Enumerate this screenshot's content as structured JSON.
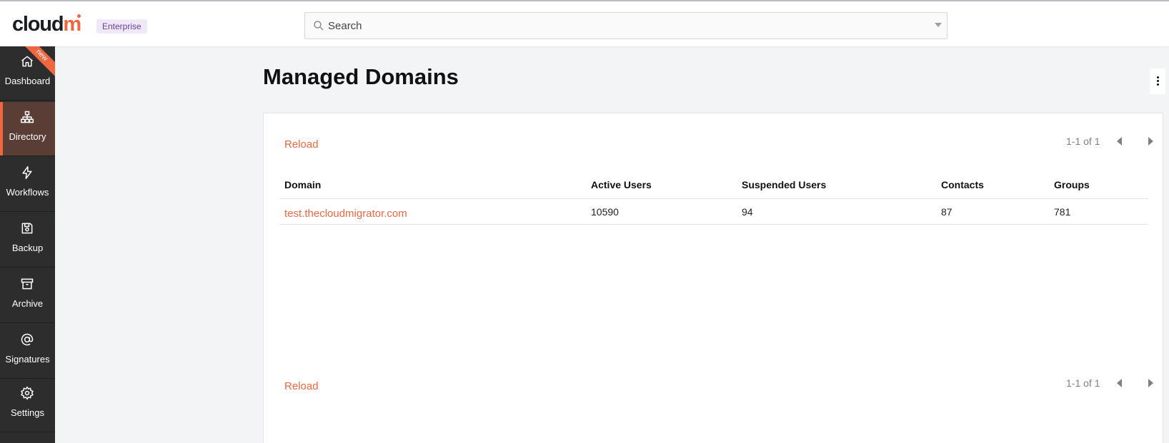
{
  "header": {
    "logo_text": "cloudm",
    "plan_badge": "Enterprise",
    "search": {
      "placeholder": "Search",
      "value": ""
    }
  },
  "sidebar": {
    "items": [
      {
        "label": "Dashboard",
        "icon": "home-icon",
        "ribbon": "new"
      },
      {
        "label": "Directory",
        "icon": "sitemap-icon",
        "active": true
      },
      {
        "label": "Workflows",
        "icon": "bolt-icon"
      },
      {
        "label": "Backup",
        "icon": "save-icon"
      },
      {
        "label": "Archive",
        "icon": "archive-box-icon"
      },
      {
        "label": "Signatures",
        "icon": "at-sign-icon"
      },
      {
        "label": "Settings",
        "icon": "gear-icon"
      }
    ]
  },
  "main": {
    "title": "Managed Domains",
    "reload_label": "Reload",
    "pager_text": "1-1 of 1",
    "table": {
      "columns": [
        "Domain",
        "Active Users",
        "Suspended Users",
        "Contacts",
        "Groups"
      ],
      "rows": [
        [
          "test.thecloudmigrator.com",
          "10590",
          "94",
          "87",
          "781"
        ]
      ]
    }
  },
  "colors": {
    "accent": "#ee6740",
    "sidebar_bg": "#2d2d2d",
    "sidebar_active_bg": "#5a3d34",
    "badge_bg": "#efe9f7",
    "badge_text": "#6b3fa0"
  }
}
